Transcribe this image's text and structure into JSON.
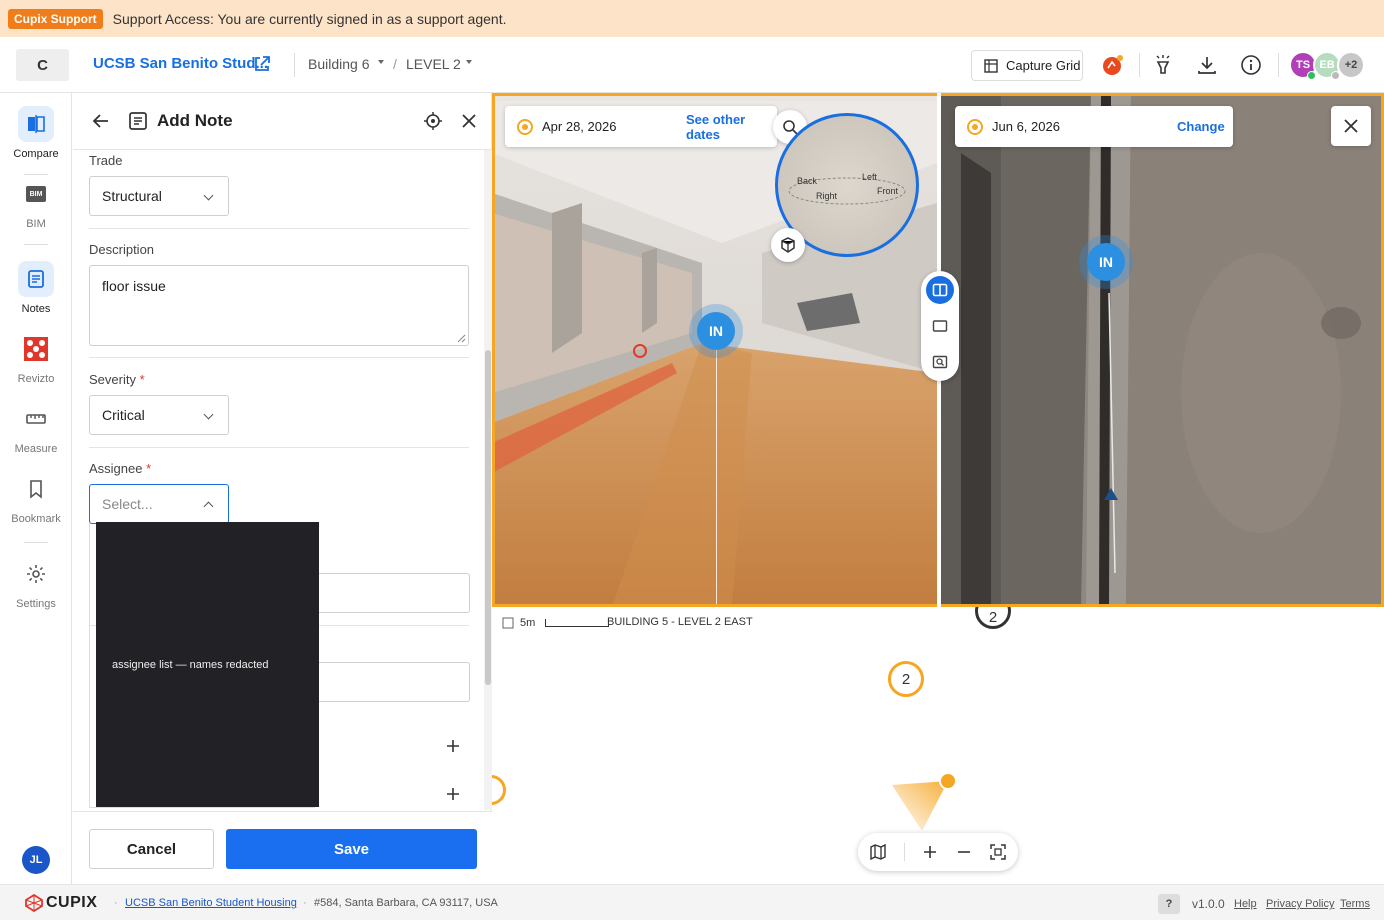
{
  "banner": {
    "badge": "Cupix Support",
    "message": "Support Access: You are currently signed in as a support agent."
  },
  "header": {
    "logo": "C",
    "project": "UCSB San Benito Stud...",
    "building": "Building 6",
    "level": "LEVEL 2",
    "capture_grid": "Capture Grid",
    "avatars": [
      {
        "initials": "TS",
        "color": "#b03fb8"
      },
      {
        "initials": "EB",
        "color": "#b6dcc0"
      },
      {
        "initials": "+2",
        "color": "#c7c7c7"
      }
    ]
  },
  "rail": {
    "items": [
      {
        "label": "Compare"
      },
      {
        "label": "BIM"
      },
      {
        "label": "Notes"
      },
      {
        "label": "Revizto"
      },
      {
        "label": "Measure"
      },
      {
        "label": "Bookmark"
      },
      {
        "label": "Settings"
      }
    ],
    "bim_badge": "BIM",
    "user": "JL"
  },
  "panel": {
    "title": "Add Note",
    "trade_label": "Trade",
    "trade_value": "Structural",
    "description_label": "Description",
    "description_value": "floor issue",
    "severity_label": "Severity",
    "severity_value": "Critical",
    "assignee_label": "Assignee",
    "assignee_placeholder": "Select...",
    "required_mark": "*",
    "dropdown_text": "assignee list — names redacted",
    "cancel": "Cancel",
    "save": "Save"
  },
  "viewer_left": {
    "date": "Apr 28, 2026",
    "link": "See other dates",
    "compass": {
      "back": "Back",
      "left": "Left",
      "right": "Right",
      "front": "Front"
    },
    "marker": "IN"
  },
  "viewer_right": {
    "date": "Jun 6, 2026",
    "link": "Change",
    "marker": "IN"
  },
  "map": {
    "scale": "5m",
    "title": "BUILDING 5 - LEVEL 2 EAST",
    "marker_top": "2",
    "marker_mid": "2"
  },
  "footer": {
    "brand": "CUPIX",
    "project_link": "UCSB San Benito Student Housing",
    "address": "#584, Santa Barbara, CA 93117, USA",
    "help_q": "?",
    "version": "v1.0.0",
    "help": "Help",
    "privacy": "Privacy Policy",
    "terms": "Terms"
  },
  "colors": {
    "accent": "#1a6fe0",
    "capture_border": "#f5a623",
    "banner": "#fde3c8",
    "badge": "#f07d1a"
  }
}
